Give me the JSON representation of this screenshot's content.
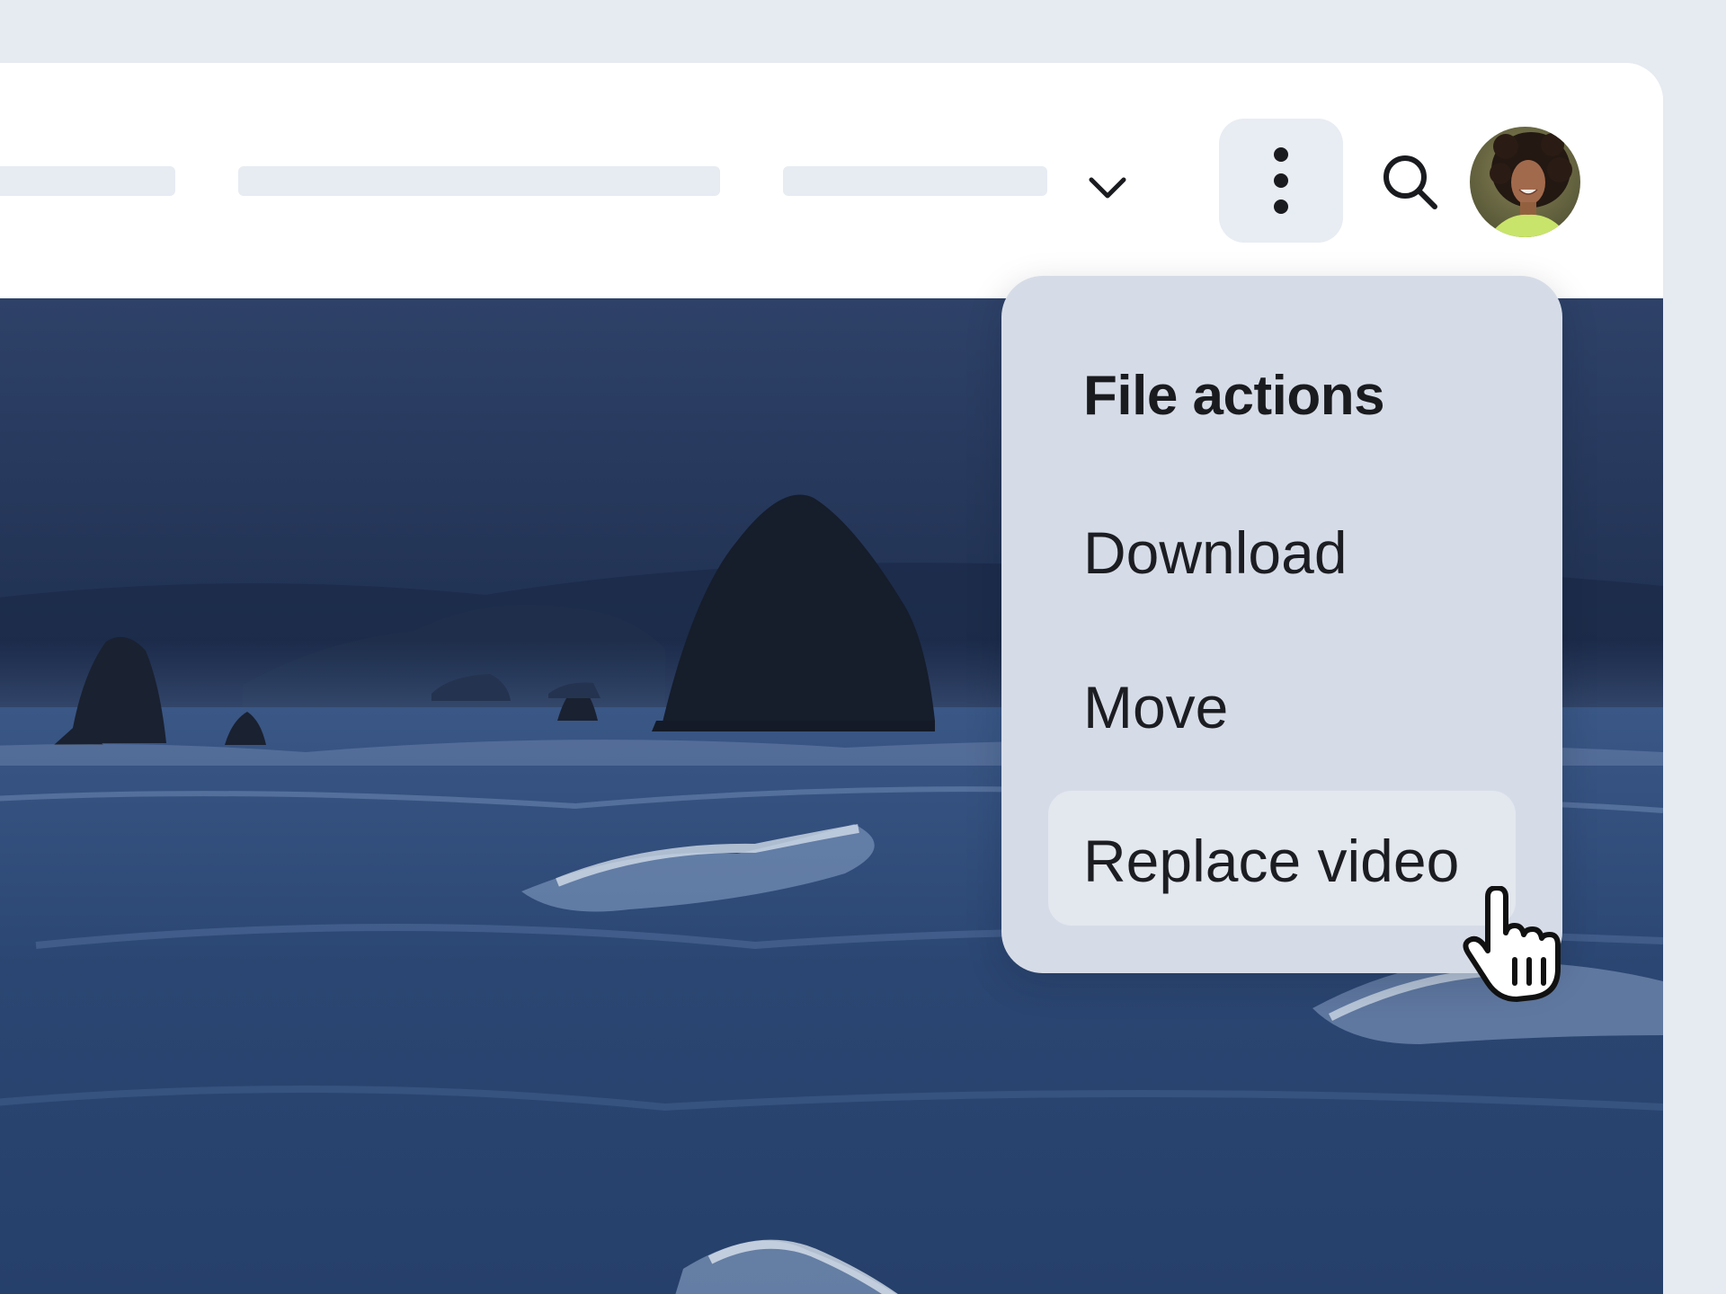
{
  "header": {
    "dropdown_icon": "chevron-down-icon",
    "more_icon": "vertical-ellipsis-icon",
    "search_icon": "search-icon",
    "avatar_icon": "user-avatar"
  },
  "menu": {
    "title": "File actions",
    "items": [
      {
        "label": "Download"
      },
      {
        "label": "Move"
      },
      {
        "label": "Replace video",
        "highlighted": true
      }
    ]
  },
  "pointer": {
    "icon": "hand-pointer-cursor-icon"
  },
  "colors": {
    "page_background": "#e6eaf1",
    "window_background": "#ffffff",
    "placeholder": "#e7ebf2",
    "menu_background": "#d6dce7",
    "menu_highlight": "#e3e7ee",
    "text": "#1c1d22"
  }
}
